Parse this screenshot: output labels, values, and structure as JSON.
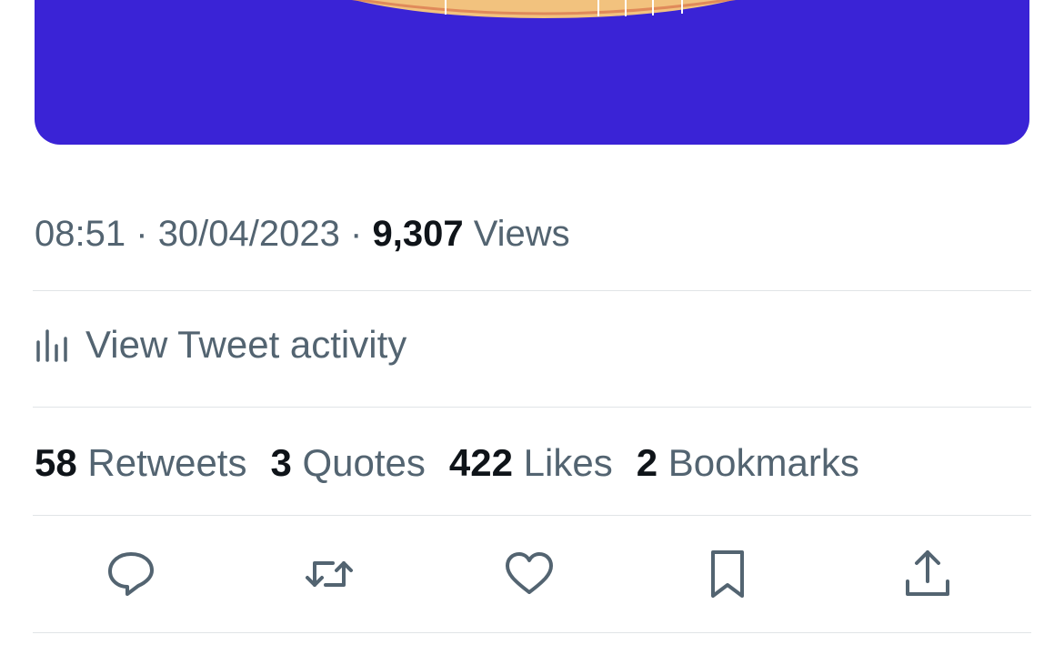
{
  "tweet": {
    "time": "08:51",
    "separator": "·",
    "date": "30/04/2023",
    "views_count": "9,307",
    "views_label": "Views"
  },
  "activity": {
    "label": "View Tweet activity",
    "icon": "analytics-icon"
  },
  "stats": [
    {
      "count": "58",
      "label": "Retweets"
    },
    {
      "count": "3",
      "label": "Quotes"
    },
    {
      "count": "422",
      "label": "Likes"
    },
    {
      "count": "2",
      "label": "Bookmarks"
    }
  ],
  "actions": [
    {
      "icon": "reply-icon"
    },
    {
      "icon": "retweet-icon"
    },
    {
      "icon": "like-icon"
    },
    {
      "icon": "bookmark-icon"
    },
    {
      "icon": "share-icon"
    }
  ],
  "colors": {
    "media_background": "#3a23d6",
    "text_secondary": "#536471",
    "text_primary": "#0f1419",
    "divider": "#e1e4e7"
  }
}
